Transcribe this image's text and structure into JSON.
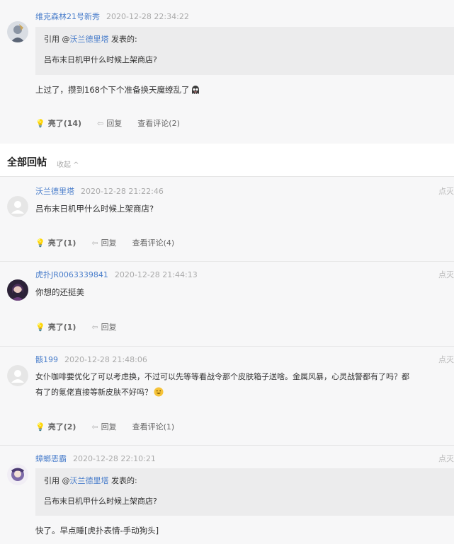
{
  "top_post": {
    "username": "维克森林21号新秀",
    "time": "2020-12-28 22:34:22",
    "quote_prefix": "引用 @",
    "quote_user": "沃兰德里塔",
    "quote_suffix": " 发表的:",
    "quote_text": "吕布末日机甲什么时候上架商店?",
    "content": "上过了，攒到168个下个准备换天魔缭乱了",
    "like_label": "亮了(14)",
    "reply_label": "回复",
    "comments_label": "查看评论(2)"
  },
  "section": {
    "title": "全部回帖",
    "collapse_label": "收起 ^"
  },
  "replies": [
    {
      "username": "沃兰德里塔",
      "time": "2020-12-28 21:22:46",
      "report": "点灭",
      "content": "吕布末日机甲什么时候上架商店?",
      "like_label": "亮了(1)",
      "reply_label": "回复",
      "comments_label": "查看评论(4)"
    },
    {
      "username": "虎扑JR0063339841",
      "time": "2020-12-28 21:44:13",
      "report": "点灭",
      "content": "你想的还挺美",
      "like_label": "亮了(1)",
      "reply_label": "回复"
    },
    {
      "username": "骸199",
      "time": "2020-12-28 21:48:06",
      "report": "点灭",
      "content_line1": "女仆咖啡要优化了可以考虑换，不过可以先等等看战令那个皮肤箱子送啥。金属风暴，心灵战警都有了吗？都",
      "content_line2": "有了的氪佬直接等新皮肤不好吗？",
      "like_label": "亮了(2)",
      "reply_label": "回复",
      "comments_label": "查看评论(1)"
    },
    {
      "username": "蟑螂恶霸",
      "time": "2020-12-28 22:10:21",
      "report": "点灭",
      "quote_prefix": "引用 @",
      "quote_user": "沃兰德里塔",
      "quote_suffix": " 发表的:",
      "quote_text": "吕布末日机甲什么时候上架商店?",
      "content": "快了。早点睡[虎扑表情-手动狗头]"
    }
  ],
  "icons": {
    "like": "lightbulb-icon",
    "reply": "reply-arrow-icon",
    "collapse": "chevron-up-icon"
  },
  "colors": {
    "username": "#4a7ecb",
    "post_bg": "#f7f7f8",
    "quote_bg": "#ececed"
  }
}
